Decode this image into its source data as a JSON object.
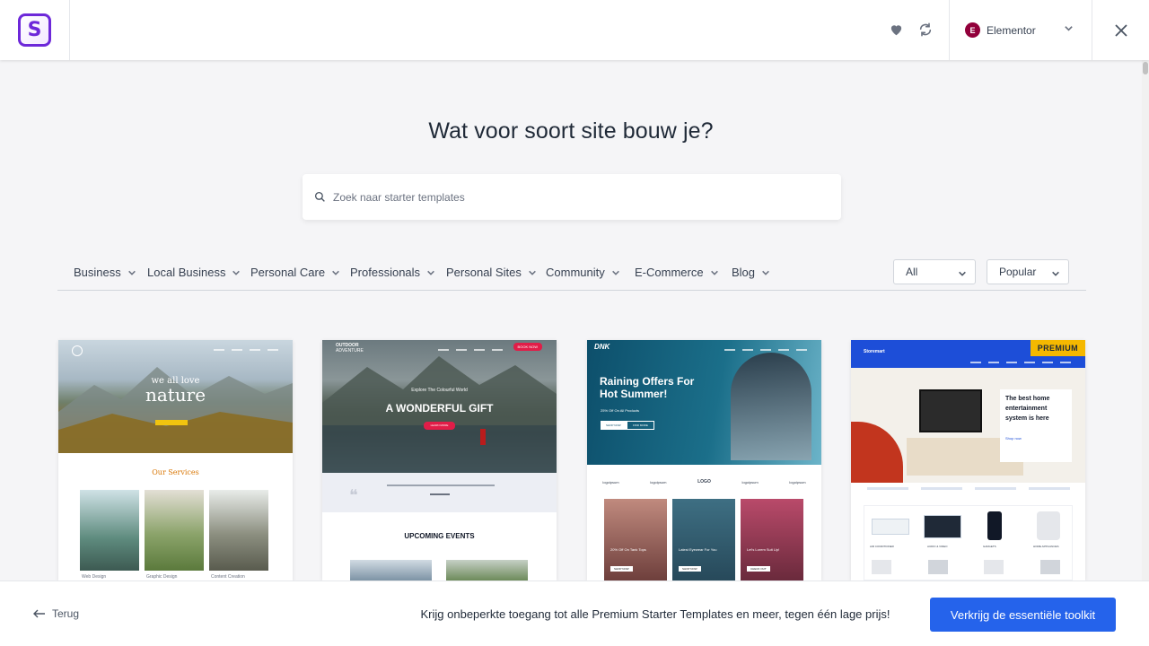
{
  "header": {
    "logo_letter": "S",
    "builder": {
      "badge": "E",
      "name": "Elementor"
    }
  },
  "main": {
    "title": "Wat voor soort site bouw je?",
    "search_placeholder": "Zoek naar starter templates"
  },
  "filters": {
    "categories": [
      {
        "label": "Business"
      },
      {
        "label": "Local Business"
      },
      {
        "label": "Personal Care"
      },
      {
        "label": "Professionals"
      },
      {
        "label": "Personal Sites"
      },
      {
        "label": "Community"
      },
      {
        "label": "E-Commerce"
      },
      {
        "label": "Blog"
      }
    ],
    "type_select": "All",
    "sort_select": "Popular"
  },
  "templates": [
    {
      "hero_line1": "we all love",
      "hero_line2": "nature",
      "section_title": "Our Services",
      "services": [
        "Web Design",
        "Graphic Design",
        "Content Creation"
      ]
    },
    {
      "brand_line1": "OUTDOOR",
      "brand_line2": "ADVENTURE",
      "nav_button": "BOOK NOW",
      "hero_kicker": "Explore The Colourful World",
      "hero_title": "A WONDERFUL GIFT",
      "hero_button": "LEARN MORE",
      "section_title": "UPCOMING EVENTS"
    },
    {
      "brand": "DNK",
      "hero_title": "Raining Offers For Hot Summer!",
      "hero_sub": "25% Off On All Products",
      "buttons": [
        "SHOP NOW",
        "FIND MORE"
      ],
      "logos": [
        "logoipsum",
        "logoipsum",
        "LOGO",
        "logoipsum",
        "logoipsum"
      ],
      "tiles": [
        {
          "title": "20% Off On Tank Tops",
          "button": "SHOP NOW"
        },
        {
          "title": "Latest Eyewear For You",
          "button": "SHOP NOW"
        },
        {
          "title": "Let's Lorem Suit Up!",
          "button": "CHECK OUT"
        }
      ]
    },
    {
      "badge": "PREMIUM",
      "store": "Storemart",
      "promo_title": "The best home entertainment system is here",
      "promo_button": "Shop now",
      "products": [
        "AIR CONDITIONER",
        "AUDIO & VIDEO",
        "GADGETS",
        "HOME APPLIANCES"
      ]
    }
  ],
  "footer": {
    "back_label": "Terug",
    "promo_text": "Krijg onbeperkte toegang tot alle Premium Starter Templates en meer, tegen één lage prijs!",
    "cta_label": "Verkrijg de essentiële toolkit"
  },
  "colors": {
    "accent": "#2563eb",
    "brand": "#6d28d9",
    "premium": "#f5b800",
    "elementor": "#92003b"
  }
}
